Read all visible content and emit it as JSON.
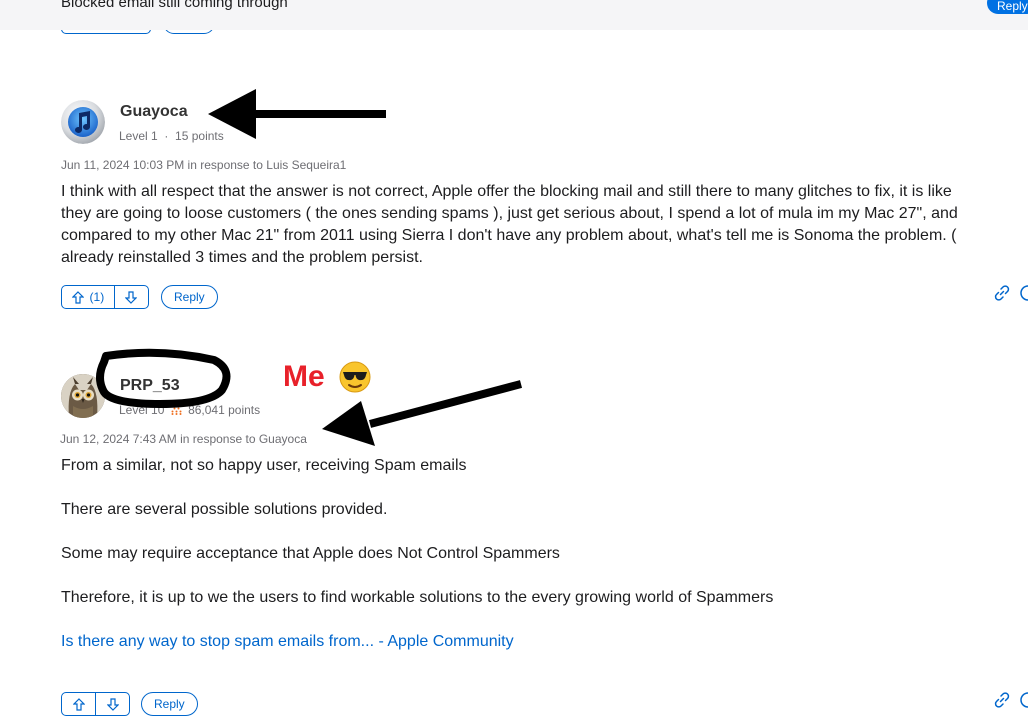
{
  "thread": {
    "title": "Blocked email still coming through",
    "reply_label": "Reply"
  },
  "post1": {
    "username": "Guayoca",
    "level": "Level 1",
    "points": "15 points",
    "date": "Jun 11, 2024 10:03 PM",
    "in_response_prefix": "in response to",
    "in_response_to": "Luis Sequeira1",
    "body_lines": [
      "I think with all respect that the answer is not correct, Apple offer the blocking mail and still there to many glitches to fix, it is like",
      "they are going to loose customers ( the ones sending spams ), just get serious about, I spend a lot of mula im my  Mac 27\", and",
      "compared to my other Mac 21\" from 2011 using Sierra I don't have any problem about, what's tell me is Sonoma the problem. (",
      "already reinstalled 3 times and the problem persist."
    ],
    "vote_count": "(1)",
    "reply_label": "Reply"
  },
  "post2": {
    "username": "PRP_53",
    "level": "Level 10",
    "points": "86,041 points",
    "date": "Jun 12, 2024 7:43 AM",
    "in_response_prefix": "in response to",
    "in_response_to": "Guayoca",
    "paragraphs": [
      "From a similar,  not so happy user, receiving Spam emails",
      "There are several possible solutions provided.",
      "Some may require acceptance that Apple does Not Control Spammers",
      "Therefore, it is up to we the users to find workable solutions to the every growing world of Spammers"
    ],
    "link_text": "Is there any way to stop spam emails from... - Apple Community",
    "reply_label": "Reply"
  },
  "annotation": {
    "me_label": "Me",
    "me_color": "#e8212a"
  },
  "colors": {
    "accent": "#0066cc",
    "reply_filled": "#0071e3",
    "meta": "#6e6e73"
  }
}
